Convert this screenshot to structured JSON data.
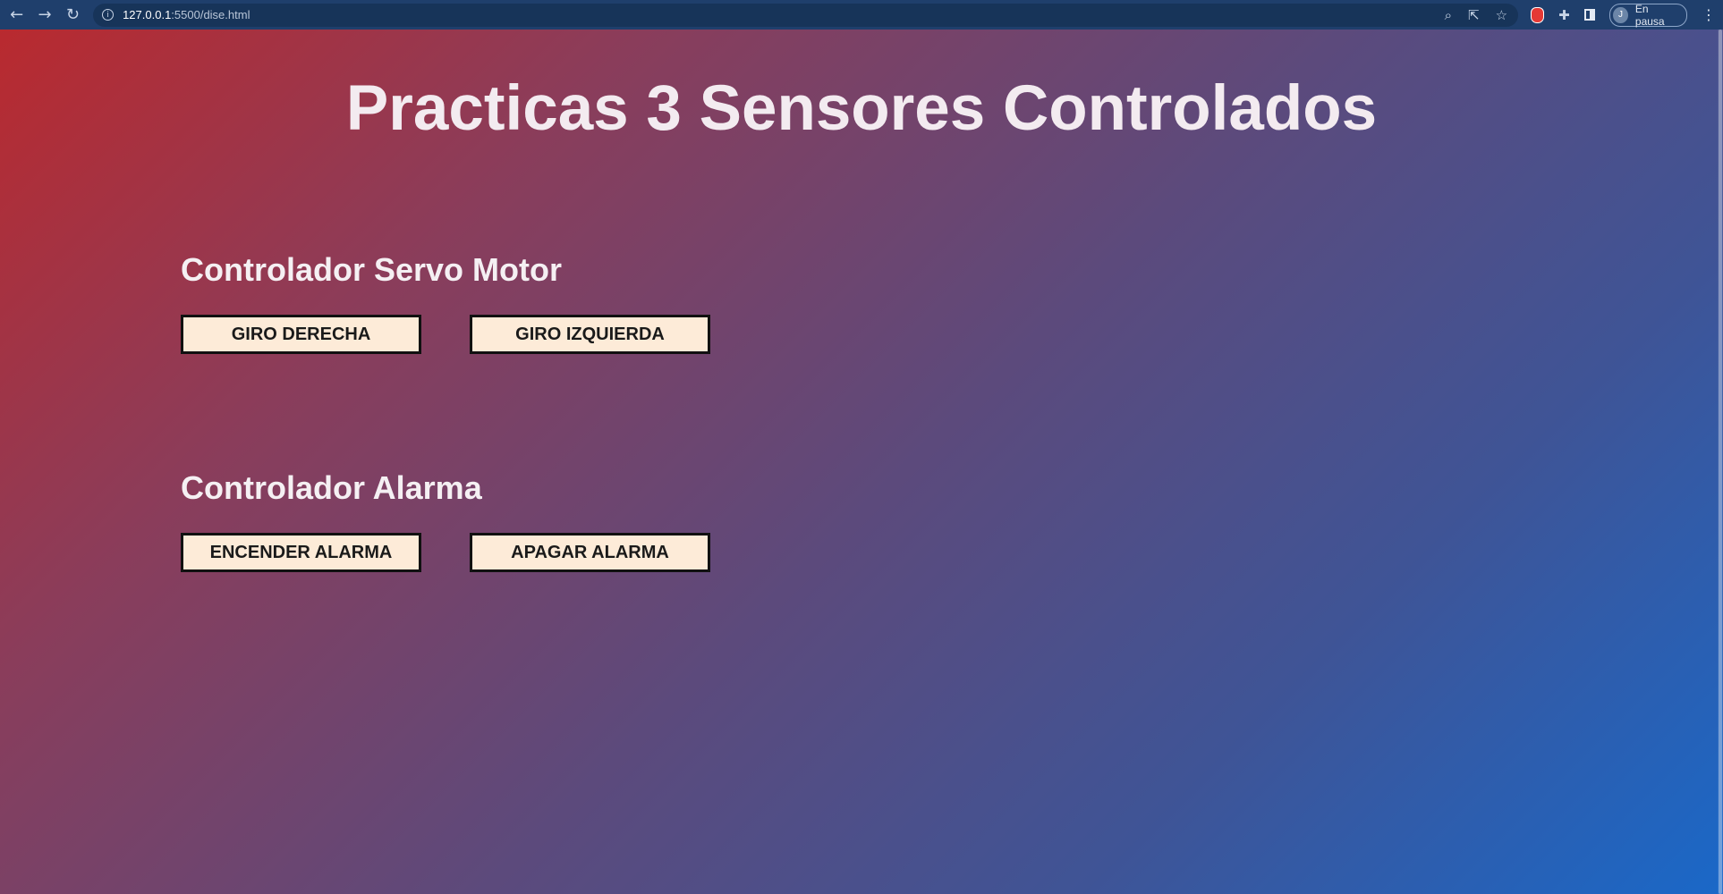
{
  "browser": {
    "url_host": "127.0.0.1",
    "url_path": ":5500/dise.html",
    "profile_initial": "J",
    "profile_status": "En pausa"
  },
  "page": {
    "title": "Practicas 3 Sensores Controlados"
  },
  "servo": {
    "title": "Controlador Servo Motor",
    "btn_right": "GIRO DERECHA",
    "btn_left": "GIRO IZQUIERDA"
  },
  "alarm": {
    "title": "Controlador Alarma",
    "btn_on": "ENCENDER ALARMA",
    "btn_off": "APAGAR ALARMA"
  },
  "colors": {
    "button_bg": "#fdebd8",
    "gradient_start": "#b92a2f",
    "gradient_end": "#1a68c8"
  }
}
